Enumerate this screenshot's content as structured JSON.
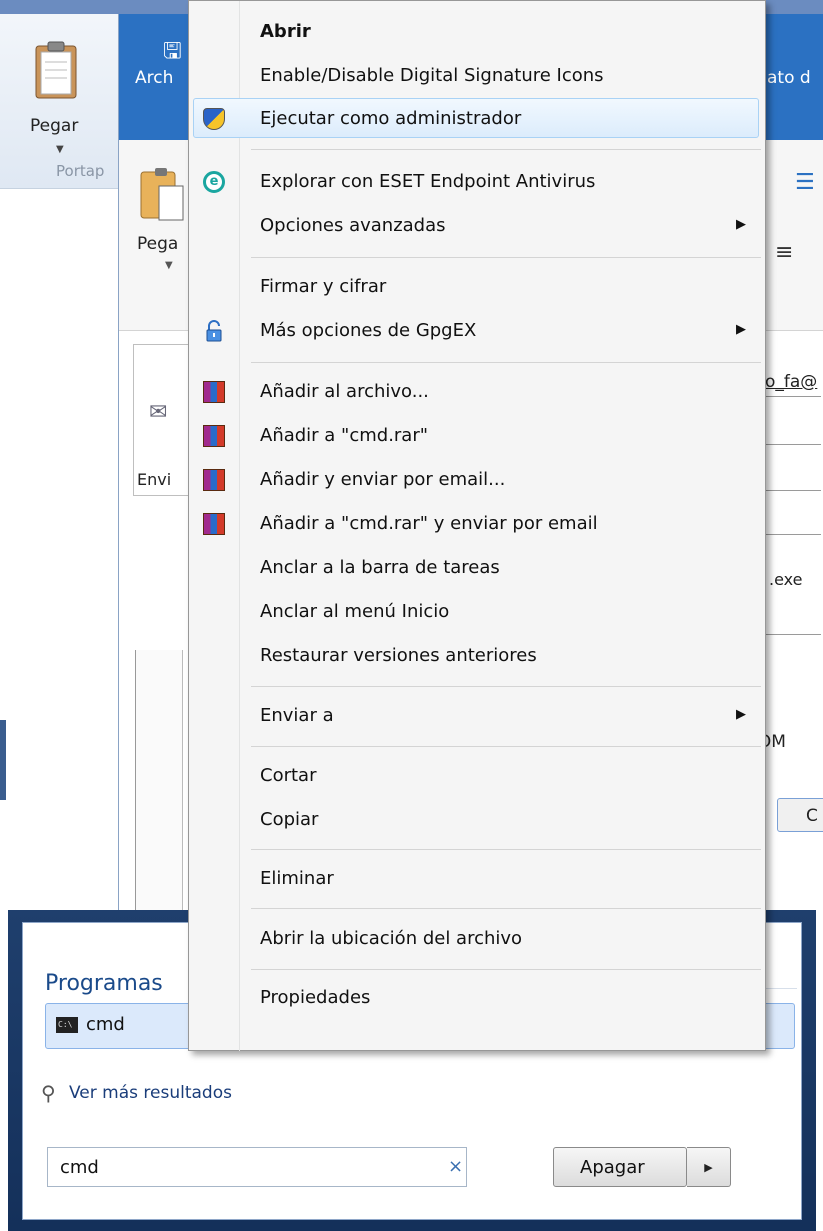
{
  "background": {
    "ribbon": {
      "paste_label": "Pegar",
      "group_label": "Portap"
    },
    "outlook": {
      "tab_left": "Arch",
      "tab_right": "ato d",
      "paste_label": "Pega",
      "send_label": "Envi",
      "to_fragment": "o_fa@",
      "exe_fragment": ".exe",
      "icom_fragment": "ICOM",
      "button_fragment": "C"
    }
  },
  "context_menu": {
    "items": [
      {
        "label": "Abrir",
        "bold": true,
        "icon": "",
        "submenu": false
      },
      {
        "label": "Enable/Disable Digital Signature Icons",
        "icon": "",
        "submenu": false
      },
      {
        "label": "Ejecutar como administrador",
        "icon": "uac-shield-icon",
        "submenu": false,
        "highlighted": true
      },
      {
        "label": "Explorar con ESET Endpoint Antivirus",
        "icon": "eset-icon",
        "submenu": false
      },
      {
        "label": "Opciones avanzadas",
        "icon": "",
        "submenu": true
      },
      {
        "label": "Firmar y cifrar",
        "icon": "",
        "submenu": false
      },
      {
        "label": "Más opciones de GpgEX",
        "icon": "lock-icon",
        "submenu": true
      },
      {
        "label": "Añadir al archivo...",
        "icon": "winrar-icon",
        "submenu": false
      },
      {
        "label": "Añadir a \"cmd.rar\"",
        "icon": "winrar-icon",
        "submenu": false
      },
      {
        "label": "Añadir y enviar por email...",
        "icon": "winrar-icon",
        "submenu": false
      },
      {
        "label": "Añadir a \"cmd.rar\" y enviar por email",
        "icon": "winrar-icon",
        "submenu": false
      },
      {
        "label": "Anclar a la barra de tareas",
        "icon": "",
        "submenu": false
      },
      {
        "label": "Anclar al menú Inicio",
        "icon": "",
        "submenu": false
      },
      {
        "label": "Restaurar versiones anteriores",
        "icon": "",
        "submenu": false
      },
      {
        "label": "Enviar a",
        "icon": "",
        "submenu": true
      },
      {
        "label": "Cortar",
        "icon": "",
        "submenu": false
      },
      {
        "label": "Copiar",
        "icon": "",
        "submenu": false
      },
      {
        "label": "Eliminar",
        "icon": "",
        "submenu": false
      },
      {
        "label": "Abrir la ubicación del archivo",
        "icon": "",
        "submenu": false
      },
      {
        "label": "Propiedades",
        "icon": "",
        "submenu": false
      }
    ],
    "submenu_arrow": "▶"
  },
  "start_menu": {
    "section_title": "Programas",
    "result_label": "cmd",
    "result_icon_text": "C:\\",
    "more_results": "Ver más resultados",
    "search_value": "cmd",
    "clear_glyph": "×",
    "shutdown_label": "Apagar",
    "shutdown_arrow": "▶"
  },
  "colors": {
    "outlook_blue": "#2b71c2",
    "highlight_border": "#a9d2f5",
    "start_menu_frame": "#1f3f6d"
  }
}
